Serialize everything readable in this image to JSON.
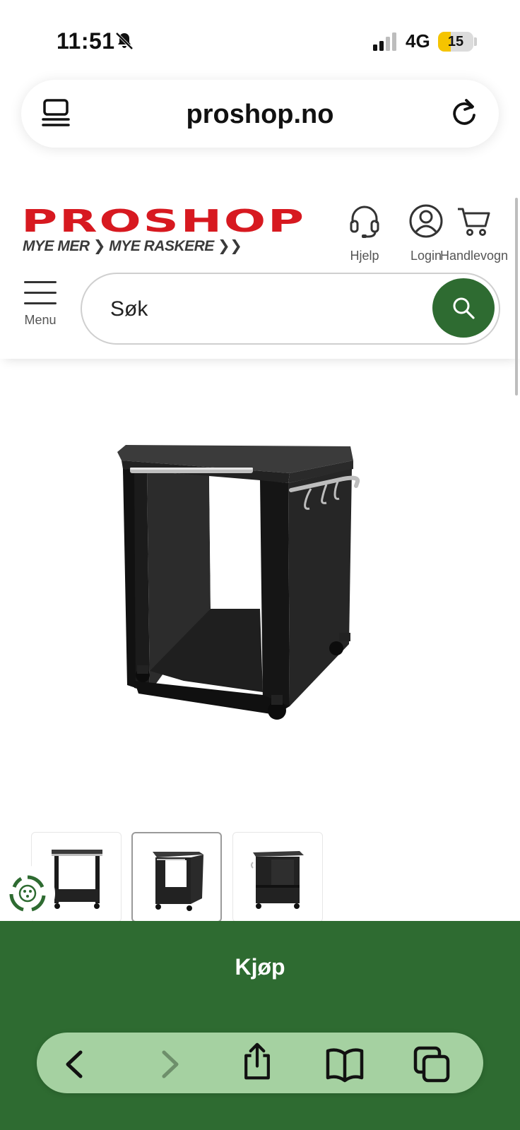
{
  "status_bar": {
    "time": "11:51",
    "network": "4G",
    "battery_level": "15",
    "battery_fraction": 0.15,
    "icons": [
      "bell-slash-icon",
      "signal-icon",
      "battery-icon"
    ]
  },
  "browser": {
    "url": "proshop.no",
    "icons": [
      "tabs-overview-icon",
      "reload-icon"
    ]
  },
  "site": {
    "logo_text": "PROSHOP",
    "tagline": "MYE MER ❯ MYE RASKERE ❯❯",
    "help_label": "Hjelp",
    "login_label": "Login",
    "cart_label": "Handlevogn",
    "menu_label": "Menu",
    "search_placeholder": "Søk",
    "brand_red": "#d71920",
    "brand_green": "#2e6b31"
  },
  "product": {
    "image_icon": "grill-cart-image",
    "thumbnail_count": 3,
    "selected_thumbnail": 2
  },
  "buy": {
    "label": "Kjøp"
  },
  "toolbar": {
    "icons": [
      "back-icon",
      "forward-icon",
      "share-icon",
      "bookmarks-icon",
      "tabs-icon"
    ],
    "color": "#a5d1a1"
  }
}
